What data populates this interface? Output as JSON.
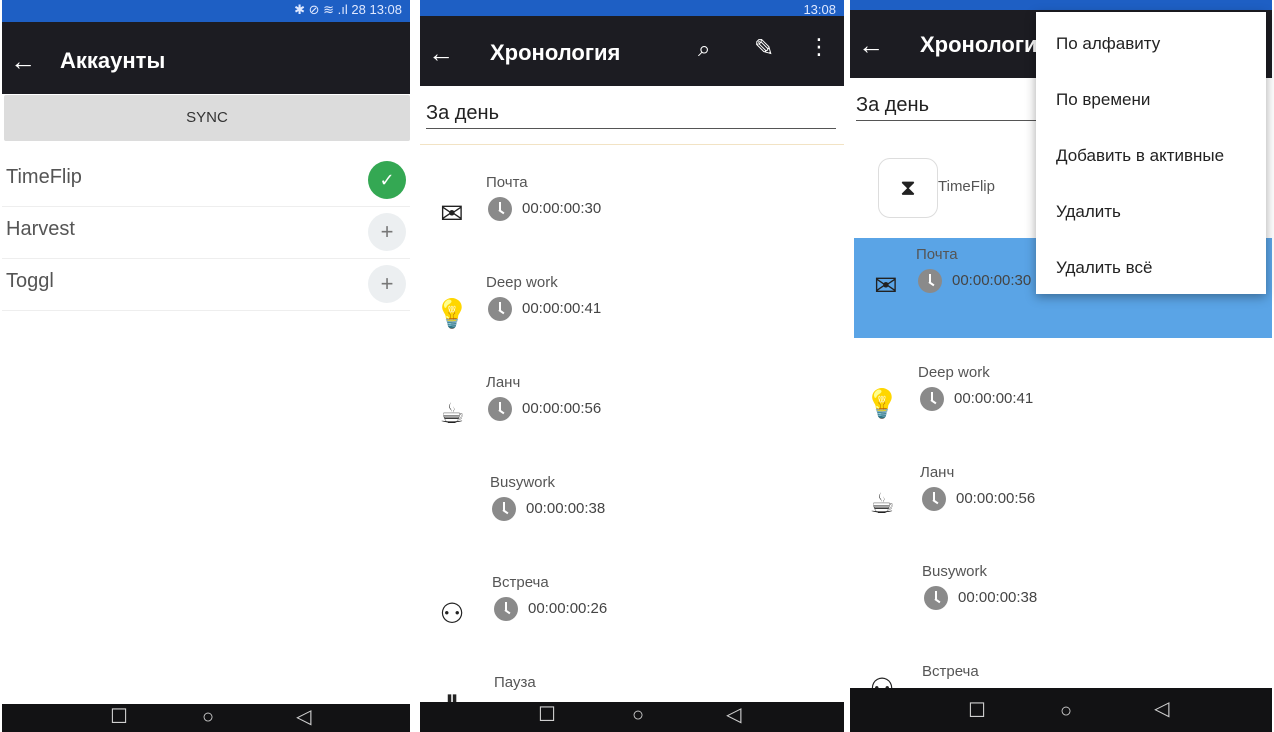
{
  "accounts_screen": {
    "status": "✱ ⊘ ≋ .ıl 28 13:08",
    "title": "Аккаунты",
    "sync_label": "SYNC",
    "accounts": [
      {
        "name": "TimeFlip",
        "state": "connected"
      },
      {
        "name": "Harvest",
        "state": "add"
      },
      {
        "name": "Toggl",
        "state": "add"
      }
    ]
  },
  "timeline_screen": {
    "status": "13:08",
    "title": "Хронология",
    "filter": "За день",
    "entries": [
      {
        "name": "Почта",
        "duration": "00:00:00:30",
        "icon": "envelope-icon"
      },
      {
        "name": "Deep work",
        "duration": "00:00:00:41",
        "icon": "lightbulb-icon"
      },
      {
        "name": "Ланч",
        "duration": "00:00:00:56",
        "icon": "coffee-cup-icon"
      },
      {
        "name": "Busywork",
        "duration": "00:00:00:38",
        "icon": ""
      },
      {
        "name": "Встреча",
        "duration": "00:00:00:26",
        "icon": "people-icon"
      },
      {
        "name": "Пауза",
        "duration": "",
        "icon": "pause-icon"
      }
    ]
  },
  "menu_screen": {
    "title": "Хронология",
    "filter": "За день",
    "device": "TimeFlip",
    "entries": [
      {
        "name": "Почта",
        "duration": "00:00:00:30",
        "selected": true
      },
      {
        "name": "Deep work",
        "duration": "00:00:00:41"
      },
      {
        "name": "Ланч",
        "duration": "00:00:00:56"
      },
      {
        "name": "Busywork",
        "duration": "00:00:00:38"
      },
      {
        "name": "Встреча",
        "duration": ""
      }
    ],
    "menu_items": [
      "По алфавиту",
      "По времени",
      "Добавить в активные",
      "Удалить",
      "Удалить всё"
    ]
  },
  "nav": {
    "recent": "☐",
    "home": "○",
    "back": "◁"
  },
  "colors": {
    "statusbar": "#1e5fc4",
    "appbar": "#1c1c22",
    "selected_row": "#5aa4e6",
    "connected": "#34a853"
  }
}
